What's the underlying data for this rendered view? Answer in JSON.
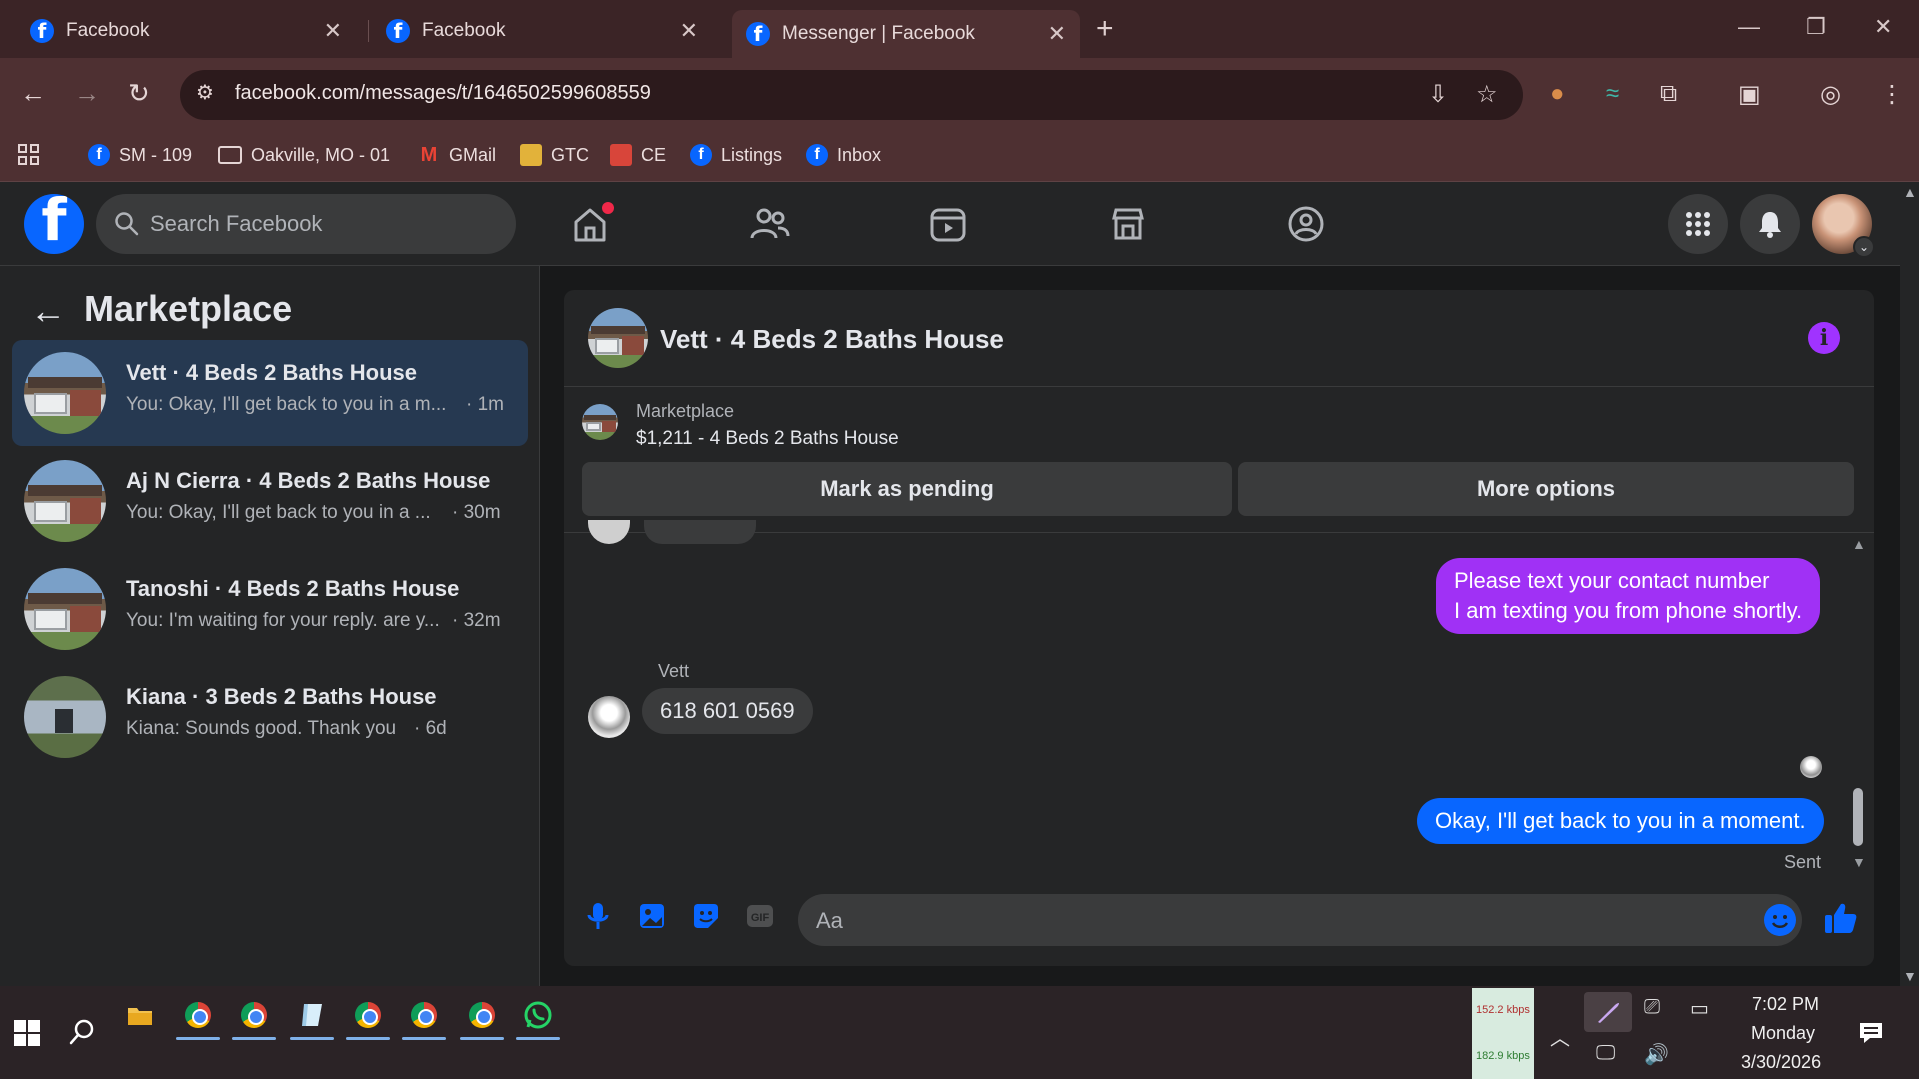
{
  "browser": {
    "tabs": [
      {
        "title": "Facebook",
        "active": false
      },
      {
        "title": "Facebook",
        "active": false
      },
      {
        "title": "Messenger | Facebook",
        "active": true
      }
    ],
    "url": "facebook.com/messages/t/1646502599608559",
    "bookmarks": [
      {
        "label": "SM - 109",
        "icon": "facebook-icon"
      },
      {
        "label": "Oakville, MO - 01",
        "icon": "folder-icon"
      },
      {
        "label": "GMail",
        "icon": "gmail-icon"
      },
      {
        "label": "GTC",
        "icon": "site-icon"
      },
      {
        "label": "CE",
        "icon": "site-icon"
      },
      {
        "label": "Listings",
        "icon": "facebook-icon"
      },
      {
        "label": "Inbox",
        "icon": "facebook-icon"
      }
    ]
  },
  "header": {
    "search_placeholder": "Search Facebook"
  },
  "sidebar": {
    "title": "Marketplace",
    "conversations": [
      {
        "name": "Vett · 4 Beds 2 Baths House",
        "preview": "You: Okay, I'll get back to you in a m...",
        "time": "· 1m",
        "selected": true
      },
      {
        "name": "Aj N Cierra · 4 Beds 2 Baths House",
        "preview": "You: Okay, I'll get back to you in a ...",
        "time": "· 30m",
        "selected": false
      },
      {
        "name": "Tanoshi · 4 Beds 2 Baths House",
        "preview": "You: I'm waiting for your reply. are y...",
        "time": "· 32m",
        "selected": false
      },
      {
        "name": "Kiana · 3 Beds 2 Baths House",
        "preview": "Kiana: Sounds good. Thank you",
        "time": "· 6d",
        "selected": false
      }
    ]
  },
  "chat": {
    "title": "Vett · 4 Beds 2 Baths House",
    "listing_source": "Marketplace",
    "listing_title": "$1,211 - 4 Beds 2 Baths House",
    "actions": {
      "mark_pending": "Mark as pending",
      "more_options": "More options"
    },
    "messages": [
      {
        "from": "me",
        "lines": [
          "Please text your contact number",
          "I am texting you from phone shortly."
        ]
      },
      {
        "from": "Vett",
        "sender_label": "Vett",
        "text": "618 601 0569"
      },
      {
        "from": "me",
        "text": "Okay, I'll get back to you in a moment.",
        "status": "Sent"
      }
    ],
    "composer_placeholder": "Aa"
  },
  "taskbar": {
    "net_up": "152.2 kbps",
    "net_down": "182.9 kbps",
    "time": "7:02 PM",
    "day": "Monday",
    "date": "3/30/2026"
  },
  "colors": {
    "outgoing_purple": "#a031f5",
    "outgoing_blue": "#0866ff",
    "selected_row": "#263951",
    "facebook_blue": "#0866ff"
  }
}
